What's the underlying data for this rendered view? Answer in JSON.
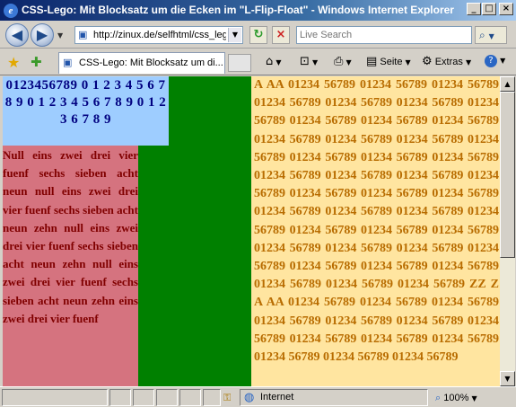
{
  "window": {
    "title": "CSS-Lego: Mit Blocksatz um die Ecken im \"L-Flip-Float\" - Windows Internet Explorer",
    "app_icon_glyph": "e",
    "controls": {
      "minimize": "_",
      "maximize": "□",
      "close": "×"
    }
  },
  "address_bar": {
    "back_glyph": "◀",
    "forward_glyph": "▶",
    "url": "http://zinux.de/selfhtml/css_lego_fliplfloat.htm",
    "refresh_glyph": "↻",
    "stop_glyph": "×",
    "search_placeholder": "Live Search",
    "search_glyph": "⌕"
  },
  "command_bar": {
    "tab_title": "CSS-Lego: Mit Blocksatz um di...",
    "home_glyph": "⌂",
    "feeds_glyph": "⊡",
    "print_glyph": "⎙",
    "page_label": "Seite",
    "tools_label": "Extras",
    "help_glyph": "?"
  },
  "content": {
    "top_left_text": "0123456789 0 1 2 3 4 5 6 7 8 9 0 1 2 3 4 5 6 7 8 9 0 1 2 3 6 7 8 9",
    "left_text": "Null eins zwei drei vier fuenf sechs sieben acht neun null eins zwei drei vier fuenf sechs sieben acht neun zehn null eins zwei drei vier fuenf sechs sieben acht neun zehn null eins zwei drei vier fuenf sechs sieben acht neun zehn eins zwei drei vier fuenf",
    "right_text": "A AA 01234 56789 01234 56789 01234 56789 01234 56789 01234 56789 01234 56789 01234 56789 01234 56789 01234 56789 01234 56789 01234 56789 01234 56789 01234 56789 01234 56789 01234 56789 01234 56789 01234 56789 01234 56789 01234 56789 01234 56789 01234 56789 01234 56789 01234 56789 01234 56789 01234 56789 01234 56789 01234 56789 01234 56789 01234 56789 01234 56789 01234 56789 01234 56789 01234 56789 01234 56789 01234 56789 01234 56789 01234 56789 01234 56789 01234 56789 01234 56789 01234 56789 ZZ Z A AA 01234 56789 01234 56789 01234 56789 01234 56789 01234 56789 01234 56789 01234 56789 01234 56789 01234 56789 01234 56789 01234 56789 01234 56789 01234 56789"
  },
  "status_bar": {
    "zone": "Internet",
    "zoom": "100%"
  },
  "colors": {
    "top_left_bg": "#9ecdff",
    "left_bg": "#d5737f",
    "green": "#008000",
    "right_bg": "#ffe5a0"
  }
}
